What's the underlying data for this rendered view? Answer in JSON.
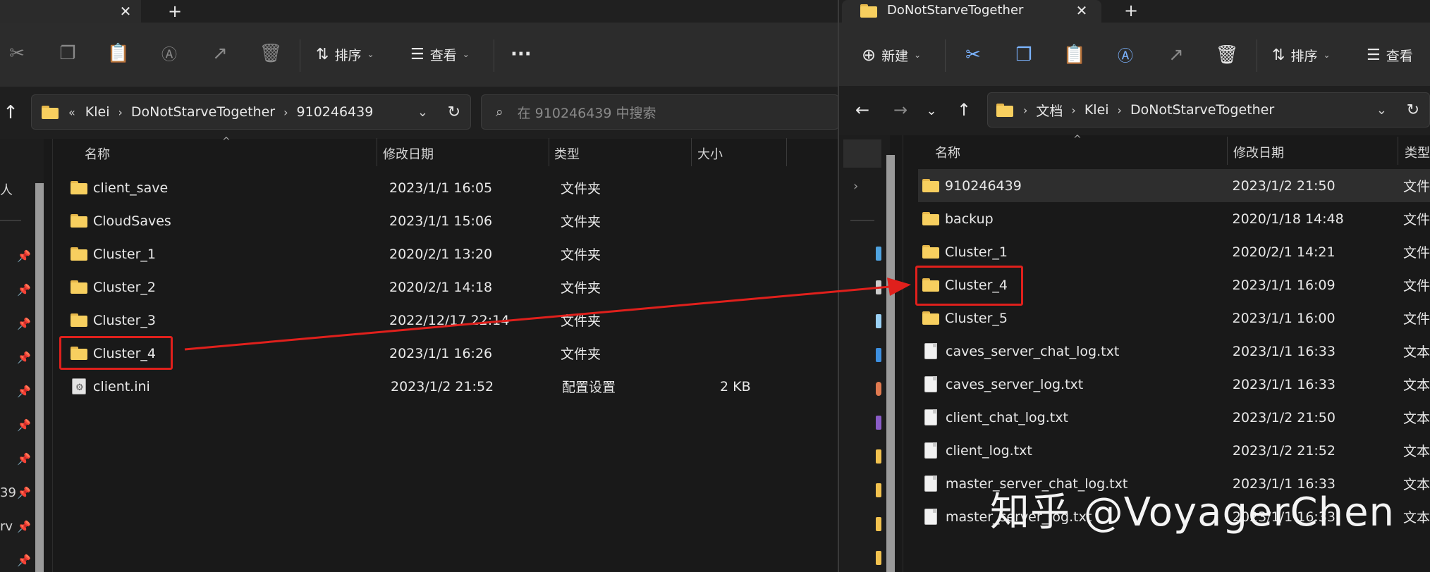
{
  "left_window": {
    "tab": {
      "close": "✕",
      "new_tab": "+"
    },
    "toolbar": {
      "sort_label": "排序",
      "view_label": "查看",
      "more": "···"
    },
    "address": {
      "crumbs": [
        "Klei",
        "DoNotStarveTogether",
        "910246439"
      ],
      "prefix": "«"
    },
    "search": {
      "placeholder": "在 910246439 中搜索"
    },
    "columns": {
      "name": "名称",
      "date": "修改日期",
      "type": "类型",
      "size": "大小"
    },
    "nav_partial": {
      "item_a": "人",
      "item_b": "39",
      "item_c": "rv"
    },
    "files": [
      {
        "name": "client_save",
        "date": "2023/1/1 16:05",
        "type": "文件夹",
        "size": "",
        "kind": "folder"
      },
      {
        "name": "CloudSaves",
        "date": "2023/1/1 15:06",
        "type": "文件夹",
        "size": "",
        "kind": "folder"
      },
      {
        "name": "Cluster_1",
        "date": "2020/2/1 13:20",
        "type": "文件夹",
        "size": "",
        "kind": "folder"
      },
      {
        "name": "Cluster_2",
        "date": "2020/2/1 14:18",
        "type": "文件夹",
        "size": "",
        "kind": "folder"
      },
      {
        "name": "Cluster_3",
        "date": "2022/12/17 22:14",
        "type": "文件夹",
        "size": "",
        "kind": "folder"
      },
      {
        "name": "Cluster_4",
        "date": "2023/1/1 16:26",
        "type": "文件夹",
        "size": "",
        "kind": "folder"
      },
      {
        "name": "client.ini",
        "date": "2023/1/2 21:52",
        "type": "配置设置",
        "size": "2 KB",
        "kind": "ini"
      }
    ]
  },
  "right_window": {
    "tab": {
      "title": "DoNotStarveTogether",
      "close": "✕",
      "new_tab": "+"
    },
    "toolbar": {
      "new_label": "新建",
      "sort_label": "排序",
      "view_label": "查看"
    },
    "address": {
      "crumbs": [
        "文档",
        "Klei",
        "DoNotStarveTogether"
      ]
    },
    "columns": {
      "name": "名称",
      "date": "修改日期",
      "type": "类型"
    },
    "files": [
      {
        "name": "910246439",
        "date": "2023/1/2 21:50",
        "type": "文件",
        "kind": "folder"
      },
      {
        "name": "backup",
        "date": "2020/1/18 14:48",
        "type": "文件",
        "kind": "folder"
      },
      {
        "name": "Cluster_1",
        "date": "2020/2/1 14:21",
        "type": "文件",
        "kind": "folder"
      },
      {
        "name": "Cluster_4",
        "date": "2023/1/1 16:09",
        "type": "文件",
        "kind": "folder"
      },
      {
        "name": "Cluster_5",
        "date": "2023/1/1 16:00",
        "type": "文件",
        "kind": "folder"
      },
      {
        "name": "caves_server_chat_log.txt",
        "date": "2023/1/1 16:33",
        "type": "文本",
        "kind": "file"
      },
      {
        "name": "caves_server_log.txt",
        "date": "2023/1/1 16:33",
        "type": "文本",
        "kind": "file"
      },
      {
        "name": "client_chat_log.txt",
        "date": "2023/1/2 21:50",
        "type": "文本",
        "kind": "file"
      },
      {
        "name": "client_log.txt",
        "date": "2023/1/2 21:52",
        "type": "文本",
        "kind": "file"
      },
      {
        "name": "master_server_chat_log.txt",
        "date": "2023/1/1 16:33",
        "type": "文本",
        "kind": "file"
      },
      {
        "name": "master_server_log.txt",
        "date": "2023/1/1 16:33",
        "type": "文本",
        "kind": "file"
      }
    ]
  },
  "watermark": "知乎 @VoyagerChen",
  "colors": {
    "annotation": "#e0201c",
    "folder": "#f7cf5f",
    "accent": "#7bb3ff"
  }
}
